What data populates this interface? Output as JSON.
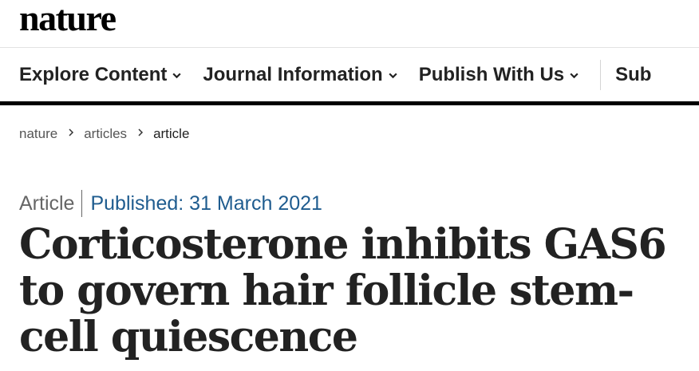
{
  "header": {
    "logo_text": "nature"
  },
  "nav": {
    "items": [
      {
        "label": "Explore Content",
        "icon": "chevron-down-icon"
      },
      {
        "label": "Journal Information",
        "icon": "chevron-down-icon"
      },
      {
        "label": "Publish With Us",
        "icon": "chevron-down-icon"
      }
    ],
    "partial_item_label": "Sub"
  },
  "breadcrumb": [
    "nature",
    "articles",
    "article"
  ],
  "article": {
    "type": "Article",
    "published": "Published: 31 March 2021",
    "title": "Corticosterone inhibits GAS6 to govern hair follicle stem-cell quiescence"
  },
  "colors": {
    "accent_link": "#1f5c8f",
    "rule": "#000000",
    "text": "#222222"
  }
}
